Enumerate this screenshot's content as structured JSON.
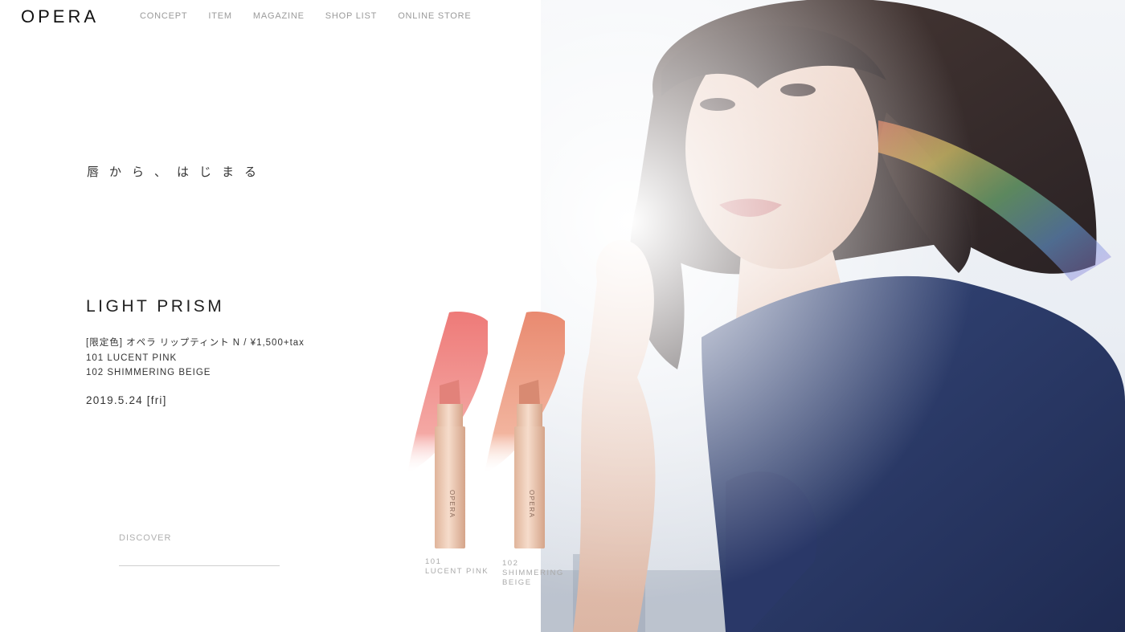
{
  "header": {
    "logo": "OPERA",
    "nav": [
      "CONCEPT",
      "ITEM",
      "MAGAZINE",
      "SHOP LIST",
      "ONLINE STORE"
    ]
  },
  "hero": {
    "tagline": "唇から、はじまる",
    "product_title": "LIGHT PRISM",
    "product_lines": [
      "[限定色] オペラ リップティント N / ¥1,500+tax",
      "101 LUCENT PINK",
      "102 SHIMMERING BEIGE"
    ],
    "release_date": "2019.5.24 [fri]",
    "cta_label": "DISCOVER"
  },
  "products": [
    {
      "code": "101",
      "name": "LUCENT PINK",
      "color": "#ee7a78",
      "tip": "#e2827a"
    },
    {
      "code": "102",
      "name": "SHIMMERING BEIGE",
      "color": "#e98a70",
      "tip": "#d88a72"
    }
  ],
  "product_case_text": "OPERA",
  "colors": {
    "background": "#ffffff",
    "nav_text": "#9a9a9a",
    "case_gold": "#e8c1a6",
    "shirt_navy": "#25345e"
  }
}
